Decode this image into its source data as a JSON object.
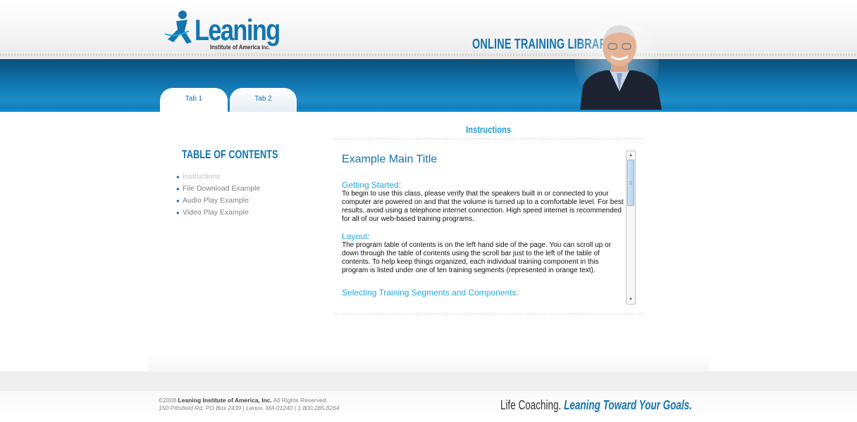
{
  "logo": {
    "word": "Leaning",
    "sub": "Institute of America",
    "inc": "Inc."
  },
  "banner": {
    "title": "ONLINE TRAINING LIBRARY"
  },
  "tabs": [
    {
      "label": "Tab 1"
    },
    {
      "label": "Tab 2"
    }
  ],
  "toc": {
    "title": "TABLE OF CONTENTS",
    "items": [
      {
        "label": "Instructions"
      },
      {
        "label": "File Download Example"
      },
      {
        "label": "Audio Play Example"
      },
      {
        "label": "Video Play Example"
      }
    ]
  },
  "content": {
    "section_title": "Instructions",
    "main_title": "Example Main Title",
    "getting_started_heading": "Getting Started:",
    "getting_started_text": "To begin to use this class, please verify that the speakers built in or connected to your computer are powered on and that the volume is turned up to a comfortable level. For best results, avoid using a telephone internet connection. High speed internet is recommended for all of our web-based training programs.",
    "layout_heading": "Layout:",
    "layout_text": "The program table of contents is on the left hand side of the page. You can scroll up or down through the table of contents using the scroll bar just to the left of the table of contents. To help keep things organized, each individual training component in this program is listed under one of ten training segments (represented in orange text).",
    "selecting_heading": "Selecting Training Segments and Components:"
  },
  "footer": {
    "copyright_prefix": "©2008 ",
    "copyright_company": "Leaning Institute of America, Inc.",
    "copyright_suffix": " All Rights Reserved.",
    "address": "150 Pittsfield Rd, PO Box 2439  |  Lenox, MA 01240  |  1.800.285.8264",
    "tagline_part1": "Life Coaching.",
    "tagline_part2": "Leaning Toward Your Goals."
  },
  "colors": {
    "brand_blue": "#1475ae",
    "accent_cyan": "#1fa8e0",
    "band_blue": "#0f74ad"
  },
  "icons": {
    "logo_figure": "running-figure-icon",
    "scroll_up": "arrow-up-icon",
    "scroll_down": "arrow-down-icon",
    "bullet": "bullet-icon"
  }
}
